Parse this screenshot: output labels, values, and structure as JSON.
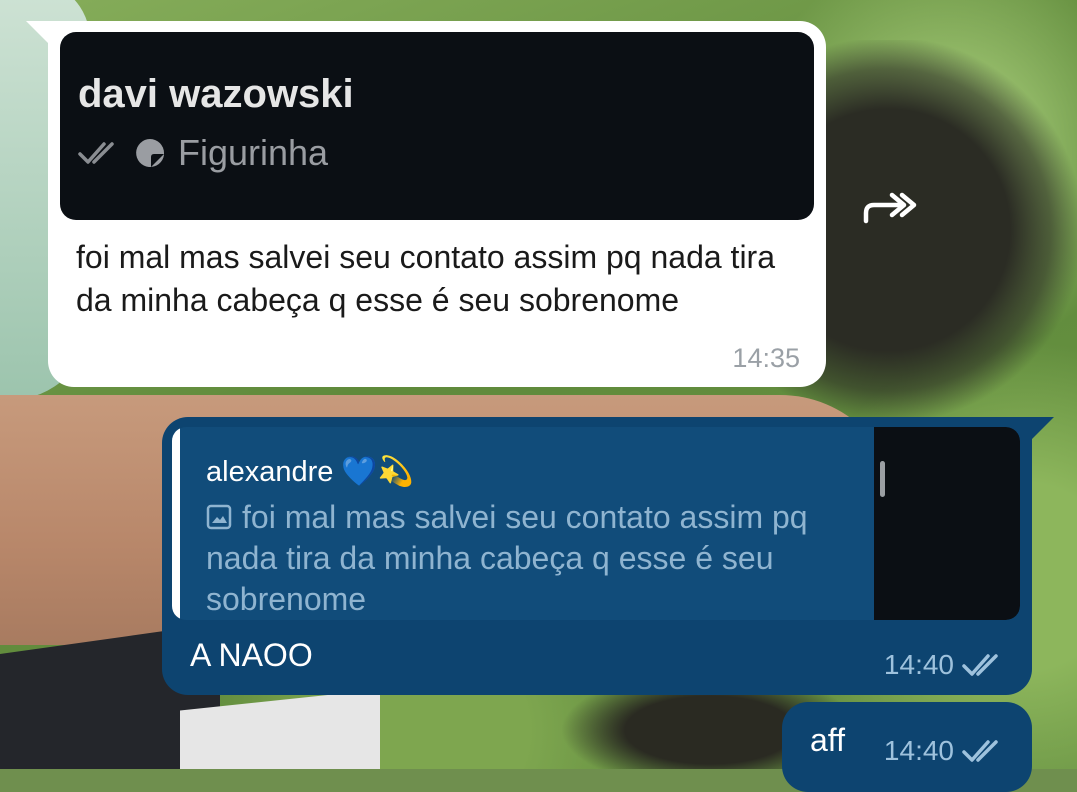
{
  "chat": {
    "incoming": {
      "reply_to": {
        "name": "davi wazowski",
        "preview_icon": "sticker-icon",
        "preview_label": "Figurinha",
        "status_icon": "double-check-icon"
      },
      "text": "foi mal mas salvei seu contato assim pq nada tira da minha cabeça q esse é seu sobrenome",
      "time": "14:35"
    },
    "forward_icon": "forward-icon",
    "outgoing": [
      {
        "quote": {
          "author": "alexandre 💙💫",
          "icon": "image-icon",
          "text": "foi mal mas salvei seu contato assim pq nada tira da minha cabeça q esse é seu sobrenome"
        },
        "text": "A NAOO",
        "time": "14:40",
        "status_icon": "double-check-icon"
      },
      {
        "text": "aff",
        "time": "14:40",
        "status_icon": "double-check-icon"
      }
    ]
  },
  "colors": {
    "incoming_bubble": "#ffffff",
    "outgoing_bubble": "#0d4470",
    "reply_card": "#0b0f14",
    "quote_text": "#8fb4d0"
  }
}
